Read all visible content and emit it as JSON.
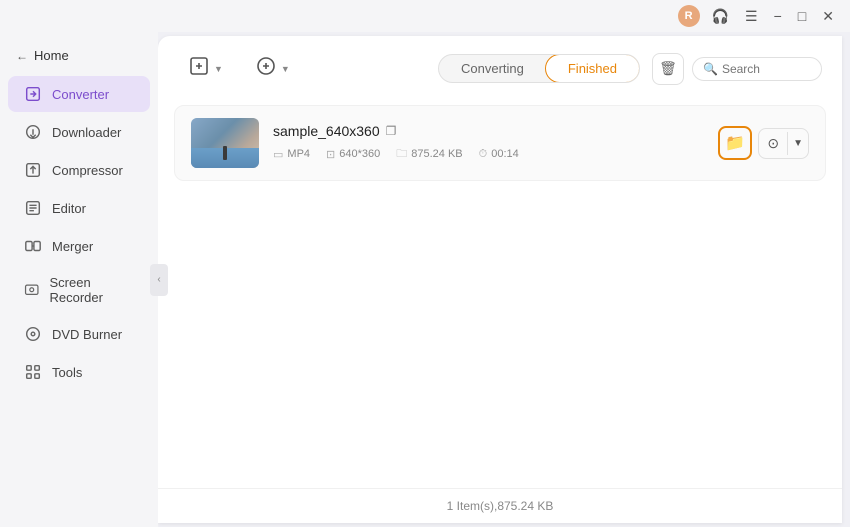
{
  "titlebar": {
    "avatar_initials": "R",
    "headphone_icon": "headphone-icon",
    "menu_icon": "menu-icon",
    "minimize_icon": "minimize-icon",
    "maximize_icon": "maximize-icon",
    "close_icon": "close-icon"
  },
  "sidebar": {
    "home_label": "Home",
    "items": [
      {
        "id": "converter",
        "label": "Converter",
        "active": true
      },
      {
        "id": "downloader",
        "label": "Downloader",
        "active": false
      },
      {
        "id": "compressor",
        "label": "Compressor",
        "active": false
      },
      {
        "id": "editor",
        "label": "Editor",
        "active": false
      },
      {
        "id": "merger",
        "label": "Merger",
        "active": false
      },
      {
        "id": "screen-recorder",
        "label": "Screen Recorder",
        "active": false
      },
      {
        "id": "dvd-burner",
        "label": "DVD Burner",
        "active": false
      },
      {
        "id": "tools",
        "label": "Tools",
        "active": false
      }
    ]
  },
  "toolbar": {
    "add_file_label": "",
    "add_url_label": "",
    "tabs": {
      "converting_label": "Converting",
      "finished_label": "Finished",
      "active": "finished"
    },
    "search_placeholder": "Search"
  },
  "file_item": {
    "name": "sample_640x360",
    "format": "MP4",
    "resolution": "640*360",
    "size": "875.24 KB",
    "duration": "00:14"
  },
  "status_bar": {
    "text": "1 Item(s),875.24 KB"
  },
  "colors": {
    "accent": "#e8860a",
    "active_sidebar": "#7c4dcc",
    "active_sidebar_bg": "#e8e0f8"
  }
}
